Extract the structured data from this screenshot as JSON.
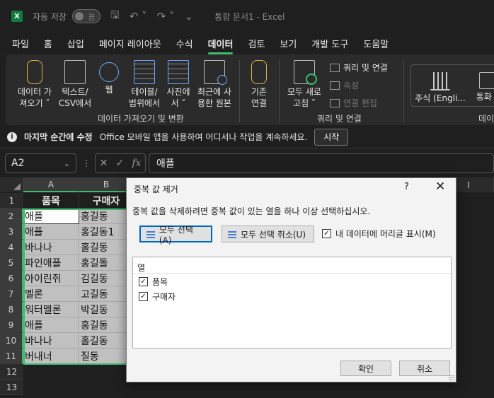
{
  "titlebar": {
    "app_icon": "X",
    "autosave_label": "자동 저장",
    "autosave_state": "끔",
    "doc_title": "통합 문서1  -  Excel"
  },
  "menu": [
    "파일",
    "홈",
    "삽입",
    "페이지 레이아웃",
    "수식",
    "데이터",
    "검토",
    "보기",
    "개발 도구",
    "도움말"
  ],
  "active_menu": "데이터",
  "ribbon": {
    "get_data": "데이터 가\n져오기 ˅",
    "text_csv": "텍스트/\nCSV에서",
    "web": "웹",
    "table_range": "테이블/\n범위에서",
    "from_picture": "사진에\n서 ˅",
    "recent_sources": "최근에 사\n용한 원본",
    "existing_conn": "기존\n연결",
    "group_get": "데이터 가져오기 및 변환",
    "refresh_all": "모두 새로\n고침 ˅",
    "queries_conn": "쿼리 및 연결",
    "properties": "속성",
    "edit_links": "연결 편집",
    "group_queries": "쿼리 및 연결",
    "stocks": "주식 (Engli...",
    "currency": "통화 (",
    "group_data_types": "데이"
  },
  "infobar": {
    "title": "마지막 순간에 수정",
    "message": "Office 모바일 앱을 사용하여 어디서나 작업을 계속하세요.",
    "button": "시작"
  },
  "formulabar": {
    "namebox": "A2",
    "value": "애플",
    "fx": "fx"
  },
  "grid": {
    "columns": [
      "A",
      "B",
      "C",
      "D",
      "E",
      "F",
      "G",
      "H",
      "I"
    ],
    "rows": [
      "1",
      "2",
      "3",
      "4",
      "5",
      "6",
      "7",
      "8",
      "9",
      "10",
      "11",
      "12",
      "13"
    ],
    "header_row": [
      "품목",
      "구매자"
    ],
    "data": [
      [
        "애플",
        "홍길동"
      ],
      [
        "애플",
        "홍길동1"
      ],
      [
        "바나나",
        "홀길동"
      ],
      [
        "파인애플",
        "홍길돌"
      ],
      [
        "아이린쥐",
        "김길동"
      ],
      [
        "멜론",
        "고길동"
      ],
      [
        "워터멜론",
        "박길동"
      ],
      [
        "애플",
        "홍길동"
      ],
      [
        "바나나",
        "홀길동"
      ],
      [
        "버내너",
        "질동"
      ]
    ]
  },
  "dialog": {
    "title": "중복 값 제거",
    "help": "?",
    "close": "✕",
    "instruction": "중복 값을 삭제하려면 중복 값이 있는 열을 하나 이상 선택하십시오.",
    "select_all": "모두 선택(A)",
    "unselect_all": "모두 선택 취소(U)",
    "my_data_has_headers": "내 데이터에 머리글 표시(M)",
    "list_header": "열",
    "columns": [
      "품목",
      "구매자"
    ],
    "ok": "확인",
    "cancel": "취소"
  }
}
